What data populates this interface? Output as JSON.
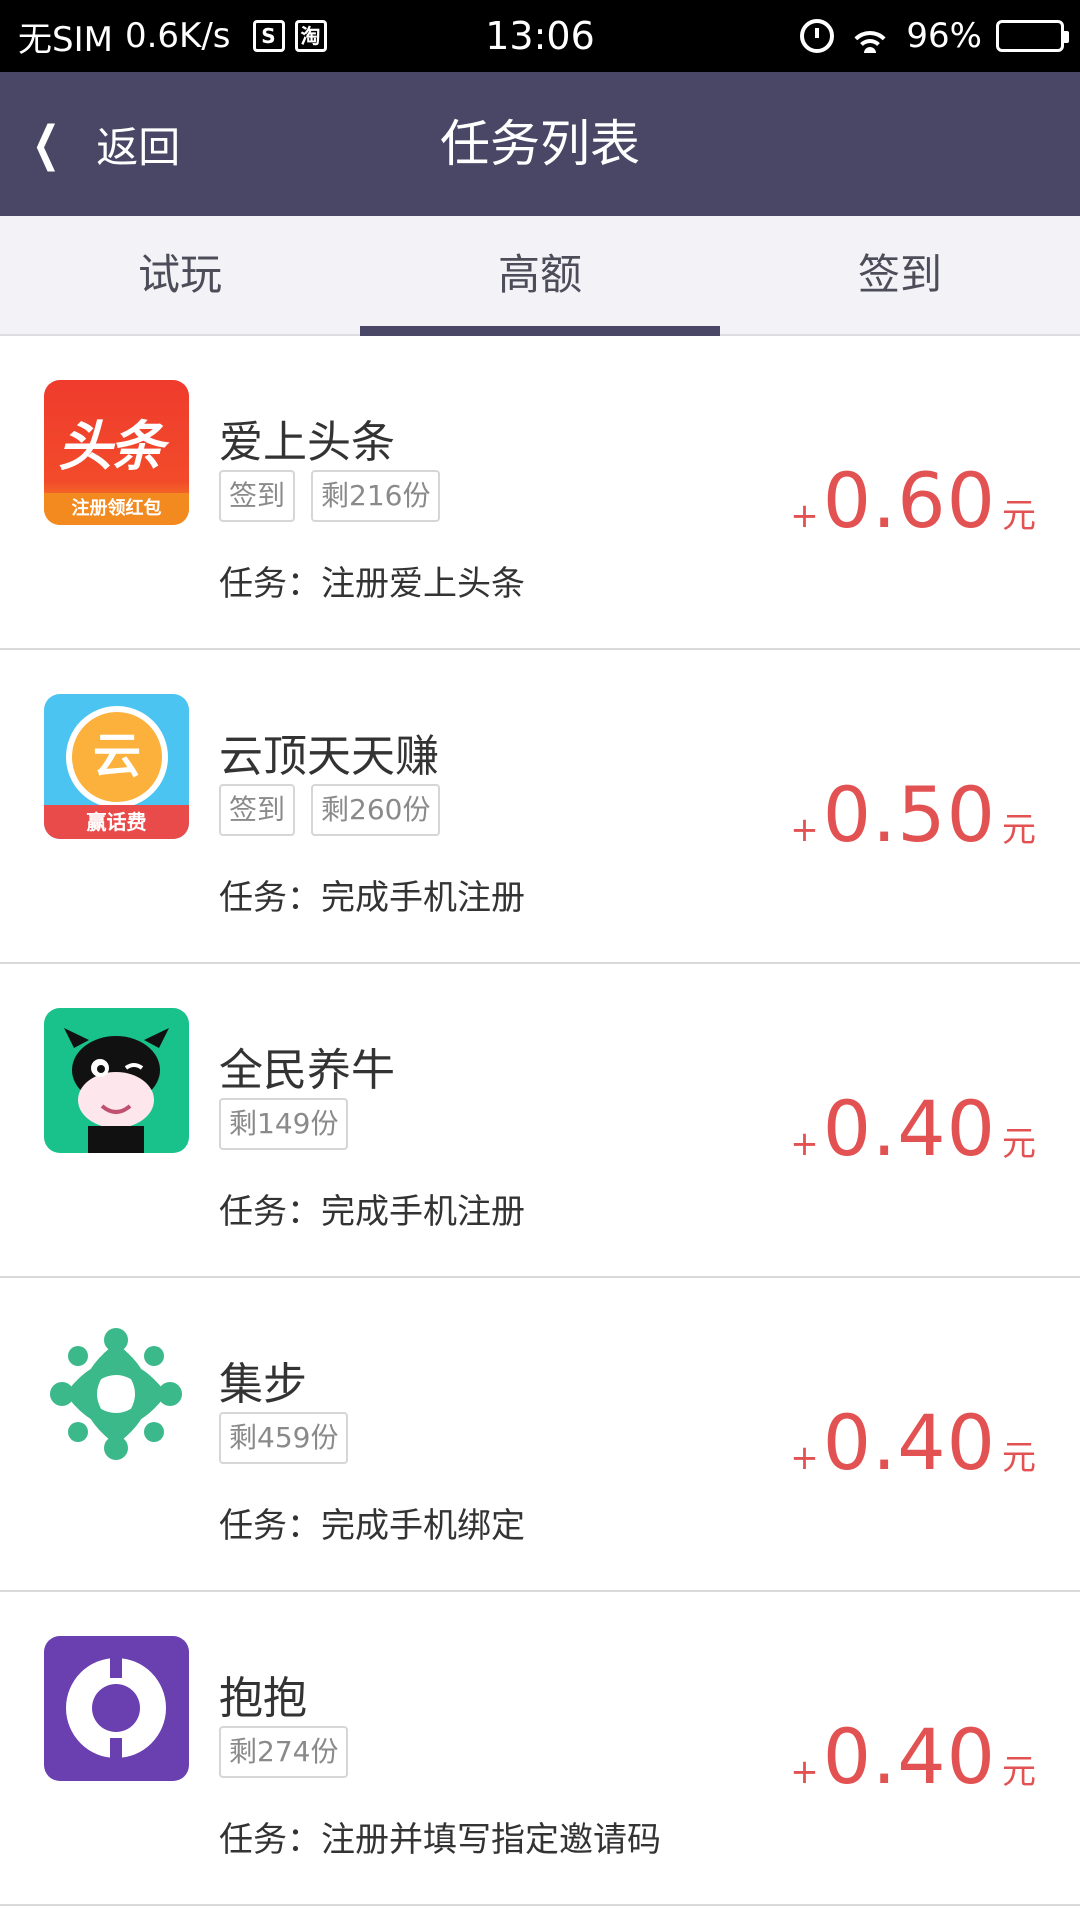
{
  "status_bar": {
    "carrier": "无SIM",
    "speed": "0.6K/s",
    "icon_s": "S",
    "icon_tao": "淘",
    "time": "13:06",
    "battery": "96%",
    "battery_level": 0.96
  },
  "header": {
    "back_label": "返回",
    "title": "任务列表"
  },
  "tabs": [
    {
      "label": "试玩",
      "active": false
    },
    {
      "label": "高额",
      "active": true
    },
    {
      "label": "签到",
      "active": false
    }
  ],
  "items": [
    {
      "name": "爱上头条",
      "tags": [
        "签到",
        "剩216份"
      ],
      "task": "任务：注册爱上头条",
      "plus": "+",
      "amount": "0.60",
      "unit": "元",
      "icon": "toutiao-app-icon",
      "icon_text": "头条",
      "icon_band": "注册领红包"
    },
    {
      "name": "云顶天天赚",
      "tags": [
        "签到",
        "剩260份"
      ],
      "task": "任务：完成手机注册",
      "plus": "+",
      "amount": "0.50",
      "unit": "元",
      "icon": "yunding-app-icon",
      "icon_text": "云",
      "icon_band": "赢话费"
    },
    {
      "name": "全民养牛",
      "tags": [
        "剩149份"
      ],
      "task": "任务：完成手机注册",
      "plus": "+",
      "amount": "0.40",
      "unit": "元",
      "icon": "cow-app-icon"
    },
    {
      "name": "集步",
      "tags": [
        "剩459份"
      ],
      "task": "任务：完成手机绑定",
      "plus": "+",
      "amount": "0.40",
      "unit": "元",
      "icon": "jibu-app-icon"
    },
    {
      "name": "抱抱",
      "tags": [
        "剩274份"
      ],
      "task": "任务：注册并填写指定邀请码",
      "plus": "+",
      "amount": "0.40",
      "unit": "元",
      "icon": "baobao-app-icon"
    }
  ],
  "colors": {
    "header_bg": "#4a4766",
    "price": "#e35252",
    "tab_bg": "#f3f2f7"
  }
}
